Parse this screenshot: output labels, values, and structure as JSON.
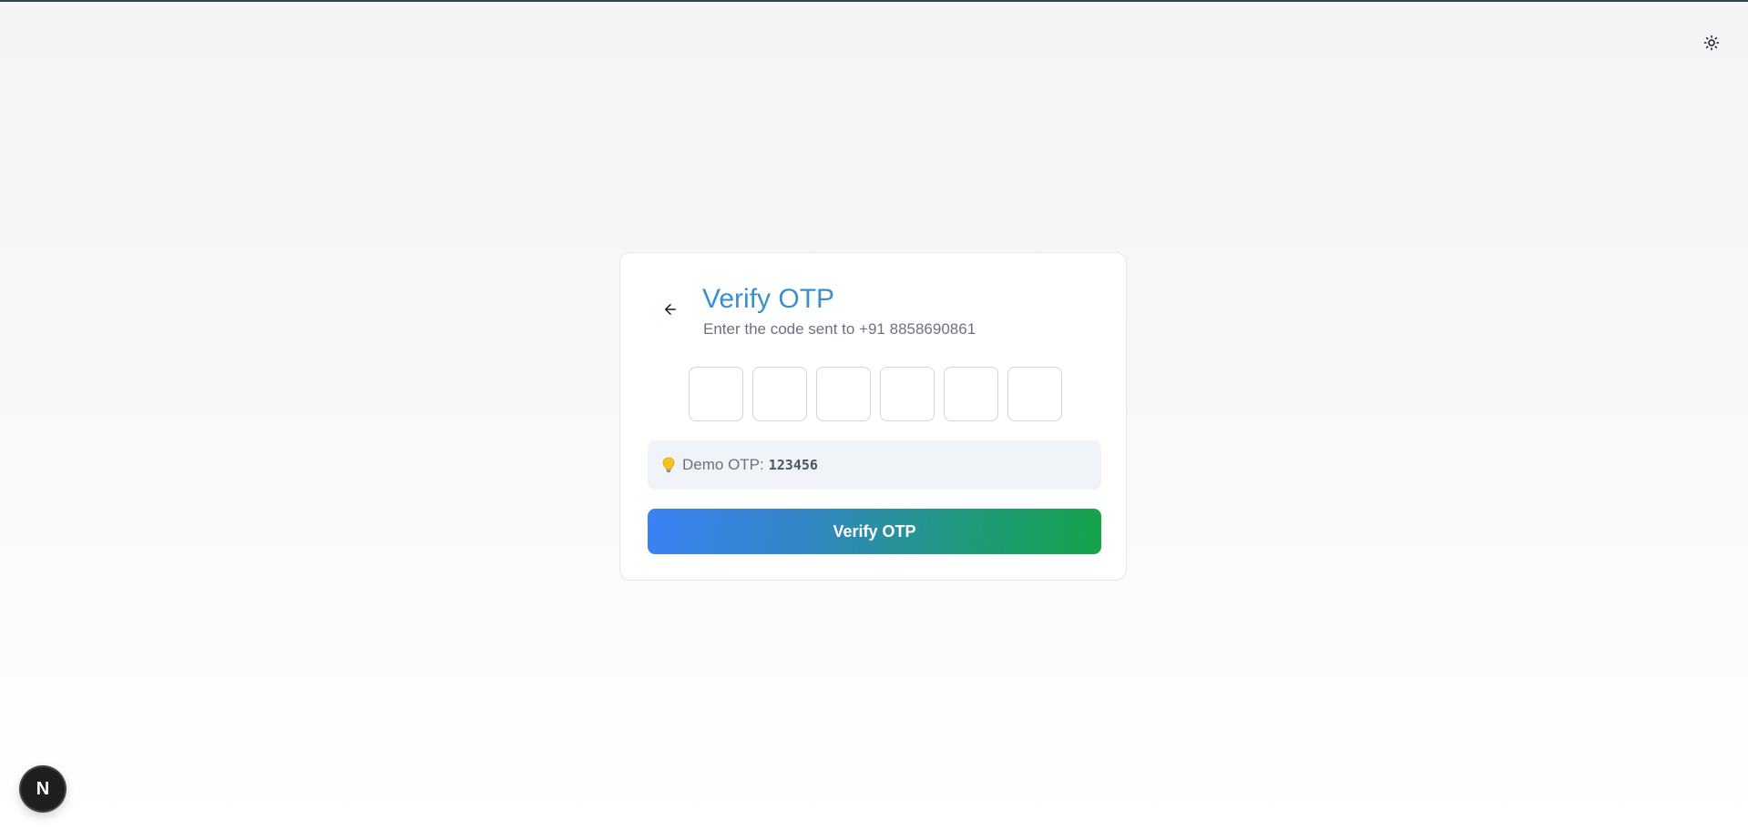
{
  "header": {
    "theme_toggle_icon": "sun-icon"
  },
  "otp_card": {
    "back_icon": "arrow-left-icon",
    "title": "Verify OTP",
    "subtitle": "Enter the code sent to +91 8858690861",
    "otp_digits": [
      "",
      "",
      "",
      "",
      "",
      ""
    ],
    "hint": {
      "icon": "lightbulb-icon",
      "label": "Demo OTP:",
      "code": "123456"
    },
    "submit_label": "Verify OTP"
  },
  "dev_indicator": {
    "letter": "N",
    "icon": "nextjs-logo-icon"
  },
  "colors": {
    "title": "#3a8fcf",
    "button_gradient_start": "#3b82f6",
    "button_gradient_end": "#16a34a",
    "hint_background": "#f0f3f7"
  }
}
